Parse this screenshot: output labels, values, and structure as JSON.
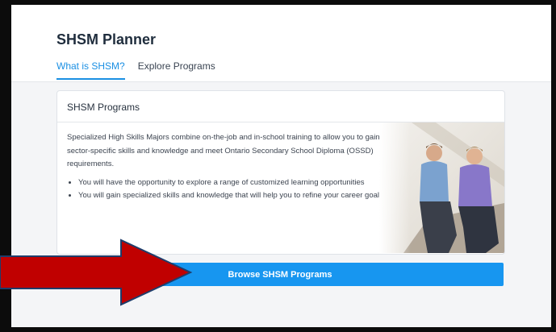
{
  "app": {
    "title": "SHSM Planner"
  },
  "tabs": [
    {
      "label": "What is SHSM?",
      "active": true
    },
    {
      "label": "Explore Programs",
      "active": false
    }
  ],
  "card": {
    "title": "SHSM Programs",
    "description": "Specialized High Skills Majors combine on-the-job and in-school training to allow you to gain sector-specific skills and knowledge and meet Ontario Secondary School Diploma (OSSD) requirements.",
    "bullets": [
      "You will have the opportunity to explore a range of customized learning opportunities",
      "You will gain specialized skills and knowledge that will help you to refine your career goals."
    ]
  },
  "browse_button": {
    "label": "Browse SHSM Programs"
  },
  "colors": {
    "accent": "#1796f0",
    "tab_active": "#1a8fe3",
    "arrow": "#c00000",
    "frame": "#0c0c0c"
  },
  "icons": {
    "arrow": "red-arrow-icon",
    "photo": "students-photo"
  }
}
